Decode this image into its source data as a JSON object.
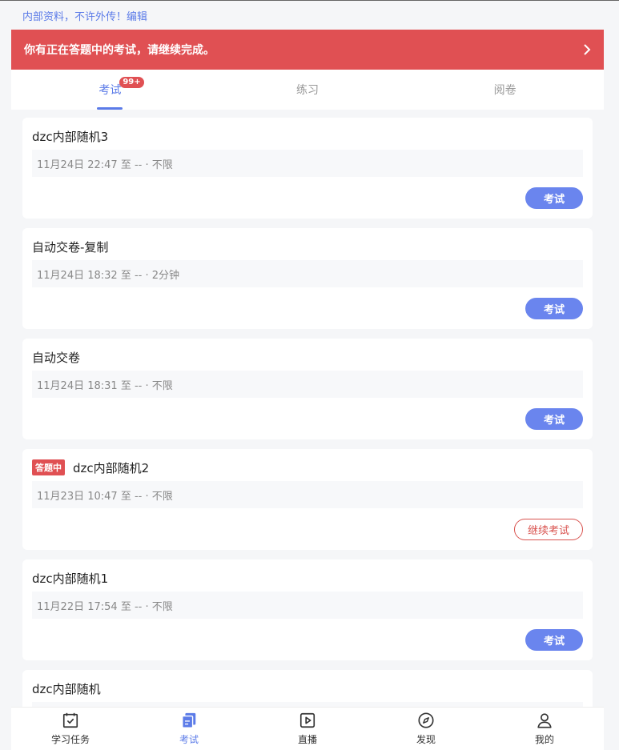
{
  "notice": "内部资料，不许外传！编辑",
  "alert": {
    "text": "你有正在答题中的考试，请继续完成。",
    "icon": "chevron-right-icon"
  },
  "tabs": [
    {
      "label": "考试",
      "badge": "99+"
    },
    {
      "label": "练习"
    },
    {
      "label": "阅卷"
    }
  ],
  "exams": [
    {
      "title": "dzc内部随机3",
      "meta": "11月24日 22:47 至 -- · 不限",
      "button": "考试"
    },
    {
      "title": "自动交卷-复制",
      "meta": "11月24日 18:32 至 -- · 2分钟",
      "button": "考试"
    },
    {
      "title": "自动交卷",
      "meta": "11月24日 18:31 至 -- · 不限",
      "button": "考试"
    },
    {
      "tag": "答题中",
      "title": "dzc内部随机2",
      "meta": "11月23日 10:47 至 -- · 不限",
      "button": "继续考试"
    },
    {
      "title": "dzc内部随机1",
      "meta": "11月22日 17:54 至 -- · 不限",
      "button": "考试"
    },
    {
      "title": "dzc内部随机",
      "meta": "",
      "button": ""
    }
  ],
  "nav": [
    {
      "label": "学习任务",
      "icon": "task-checkbox-icon"
    },
    {
      "label": "考试",
      "icon": "exam-icon"
    },
    {
      "label": "直播",
      "icon": "live-play-icon"
    },
    {
      "label": "发现",
      "icon": "compass-icon"
    },
    {
      "label": "我的",
      "icon": "user-icon"
    }
  ],
  "colors": {
    "accent": "#5b7be8",
    "alert": "#e05053",
    "button": "#6a85ee"
  }
}
